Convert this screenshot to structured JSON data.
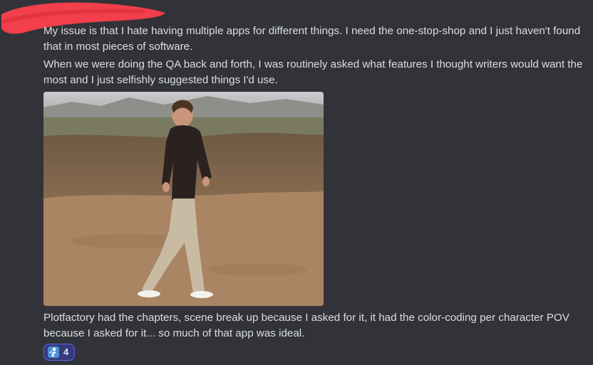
{
  "message": {
    "paragraphs": [
      {
        "line1": "My issue is that I hate having multiple apps for different things. I need the one-stop-shop and I just haven't found",
        "line2": "that in most pieces of software."
      },
      {
        "line1": "When we were doing the QA back and forth, I was routinely asked what features I thought writers would want the",
        "line2": "most and I just selfishly suggested things I'd use."
      },
      {
        "line1": "Plotfactory had the chapters, scene break up because I asked for it, it had the color-coding per character POV",
        "line2": "because I asked for it...  so much of that app was ideal."
      }
    ],
    "attachment": {
      "type": "gif",
      "icon": "man-walking-on-dirt-hill-image"
    },
    "reaction": {
      "emoji": "person-emoji",
      "count": "4",
      "selected": true
    }
  },
  "colors": {
    "background": "#313338",
    "text": "#dbdee1",
    "redaction": "#f23f4b",
    "reaction_border": "#5865f2",
    "reaction_bg": "#373a7a"
  }
}
